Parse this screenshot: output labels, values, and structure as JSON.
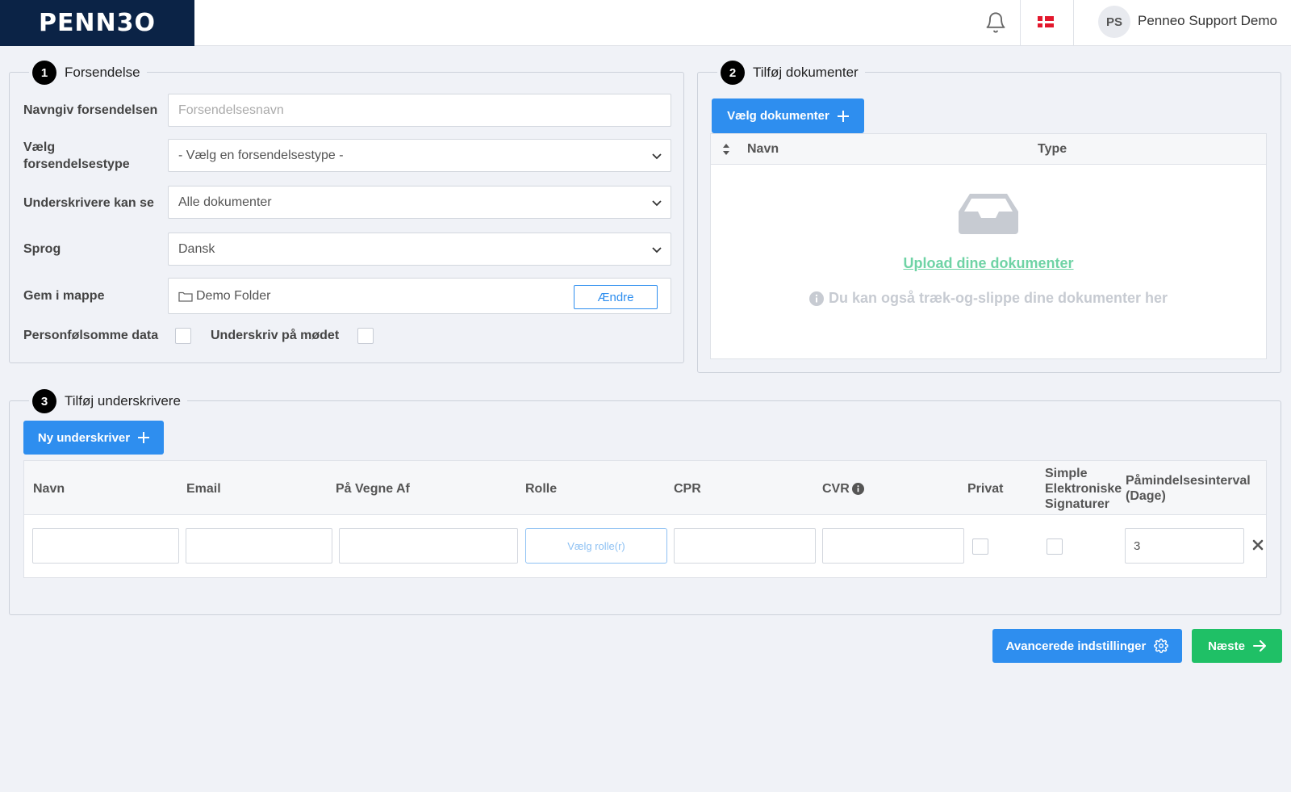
{
  "app": {
    "logo_text": "PENN3O",
    "user_initials": "PS",
    "user_name": "Penneo Support Demo",
    "icons": [
      "bell-icon",
      "flag-denmark-icon"
    ]
  },
  "section1": {
    "step": "1",
    "title": "Forsendelse",
    "name_label": "Navngiv forsendelsen",
    "name_placeholder": "Forsendelsesnavn",
    "type_label": "Vælg forsendelsestype",
    "type_value": "- Vælg en forsendelsestype -",
    "visibility_label": "Underskrivere kan se",
    "visibility_value": "Alle dokumenter",
    "language_label": "Sprog",
    "language_value": "Dansk",
    "folder_label": "Gem i mappe",
    "folder_value": "Demo Folder",
    "folder_change": "Ændre",
    "sensitive_label": "Personfølsomme data",
    "sign_meeting_label": "Underskriv på mødet"
  },
  "section2": {
    "step": "2",
    "title": "Tilføj dokumenter",
    "choose_button": "Vælg dokumenter",
    "col_name": "Navn",
    "col_type": "Type",
    "upload_link": "Upload dine dokumenter",
    "drop_hint": "Du kan også træk-og-slippe dine dokumenter her"
  },
  "section3": {
    "step": "3",
    "title": "Tilføj underskrivere",
    "new_button": "Ny underskriver",
    "cols": {
      "name": "Navn",
      "email": "Email",
      "on_behalf": "På Vegne Af",
      "role": "Rolle",
      "cpr": "CPR",
      "cvr": "CVR",
      "private": "Privat",
      "simple_sig": "Simple Elektroniske Signaturer",
      "reminder": "Påmindelsesinterval (Dage)"
    },
    "row": {
      "role_button": "Vælg rolle(r)",
      "reminder_value": "3"
    }
  },
  "footer": {
    "advanced_button": "Avancerede indstillinger",
    "next_button": "Næste"
  }
}
